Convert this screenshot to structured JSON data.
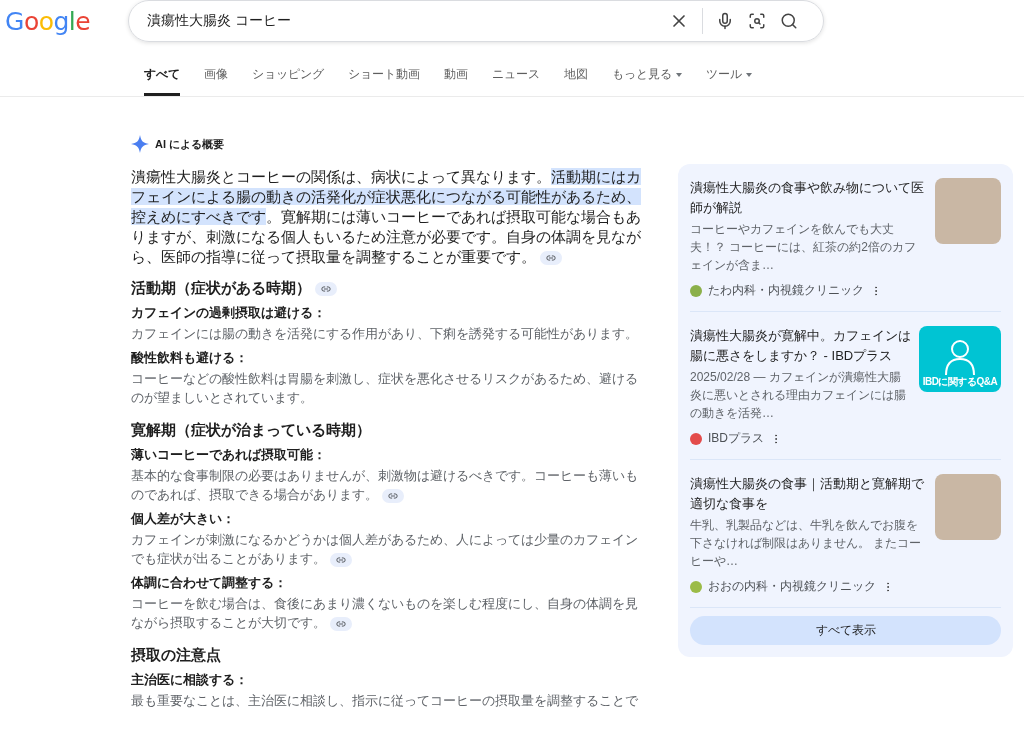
{
  "logo": "Google",
  "search": {
    "value": "潰瘍性大腸炎 コーヒー"
  },
  "tabs": [
    {
      "label": "すべて",
      "selected": true,
      "dropdown": false
    },
    {
      "label": "画像",
      "selected": false,
      "dropdown": false
    },
    {
      "label": "ショッピング",
      "selected": false,
      "dropdown": false
    },
    {
      "label": "ショート動画",
      "selected": false,
      "dropdown": false
    },
    {
      "label": "動画",
      "selected": false,
      "dropdown": false
    },
    {
      "label": "ニュース",
      "selected": false,
      "dropdown": false
    },
    {
      "label": "地図",
      "selected": false,
      "dropdown": false
    },
    {
      "label": "もっと見る",
      "selected": false,
      "dropdown": true
    },
    {
      "label": "ツール",
      "selected": false,
      "dropdown": true
    }
  ],
  "ai_overview": {
    "label": "AI による概要",
    "summary": [
      {
        "text": "潰瘍性大腸炎とコーヒーの関係は、病状によって異なります。",
        "highlighted": false
      },
      {
        "text": "活動期にはカフェインによる腸の動きの活発化が症状悪化につながる可能性があるため、控えめにすべきです",
        "highlighted": true
      },
      {
        "text": "。寛解期には薄いコーヒーであれば摂取可能な場合もありますが、刺激になる個人もいるため注意が必要です。自身の体調を見ながら、医師の指導に従って摂取量を調整することが重要です。",
        "highlighted": false
      }
    ],
    "summary_link": true,
    "sections": [
      {
        "heading": "活動期（症状がある時期）",
        "link": true,
        "items": [
          {
            "title": "カフェインの過剰摂取は避ける：",
            "text": "カフェインには腸の動きを活発にする作用があり、下痢を誘発する可能性があります。",
            "link": false
          },
          {
            "title": "酸性飲料も避ける：",
            "text": "コーヒーなどの酸性飲料は胃腸を刺激し、症状を悪化させるリスクがあるため、避けるのが望ましいとされています。",
            "link": false
          }
        ]
      },
      {
        "heading": "寛解期（症状が治まっている時期）",
        "link": false,
        "items": [
          {
            "title": "薄いコーヒーであれば摂取可能：",
            "text": "基本的な食事制限の必要はありませんが、刺激物は避けるべきです。コーヒーも薄いものであれば、摂取できる場合があります。",
            "link": true
          },
          {
            "title": "個人差が大きい：",
            "text": "カフェインが刺激になるかどうかは個人差があるため、人によっては少量のカフェインでも症状が出ることがあります。",
            "link": true
          },
          {
            "title": "体調に合わせて調整する：",
            "text": "コーヒーを飲む場合は、食後にあまり濃くないものを楽しむ程度にし、自身の体調を見ながら摂取することが大切です。",
            "link": true
          }
        ]
      },
      {
        "heading": "摂取の注意点",
        "link": false,
        "items": [
          {
            "title": "主治医に相談する：",
            "text": "最も重要なことは、主治医に相談し、指示に従ってコーヒーの摂取量を調整することで",
            "link": false
          }
        ]
      }
    ]
  },
  "sources": [
    {
      "title": "潰瘍性大腸炎の食事や飲み物について医師が解説",
      "snippet": "コーヒーやカフェインを飲んでも大丈夫！？ コーヒーには、紅茶の約2倍のカフェインが含ま…",
      "site": "たわ内科・内視鏡クリニック",
      "kind": "photo",
      "color": "#8bb04a"
    },
    {
      "title": "潰瘍性大腸炎が寛解中。カフェインは腸に悪さをしますか？ - IBDプラス",
      "snippet": "2025/02/28 — カフェインが潰瘍性大腸炎に悪いとされる理由カフェインには腸の動きを活発…",
      "site": "IBDプラス",
      "kind": "banner",
      "thumb_text": "IBDに関するQ&A",
      "color": "#e34b4b"
    },
    {
      "title": "潰瘍性大腸炎の食事｜活動期と寛解期で適切な食事を",
      "snippet": "牛乳、乳製品などは、牛乳を飲んでお腹を下さなければ制限はありません。 またコーヒーや…",
      "site": "おおの内科・内視鏡クリニック",
      "kind": "photo",
      "color": "#9bbb48"
    }
  ],
  "show_all": "すべて表示"
}
